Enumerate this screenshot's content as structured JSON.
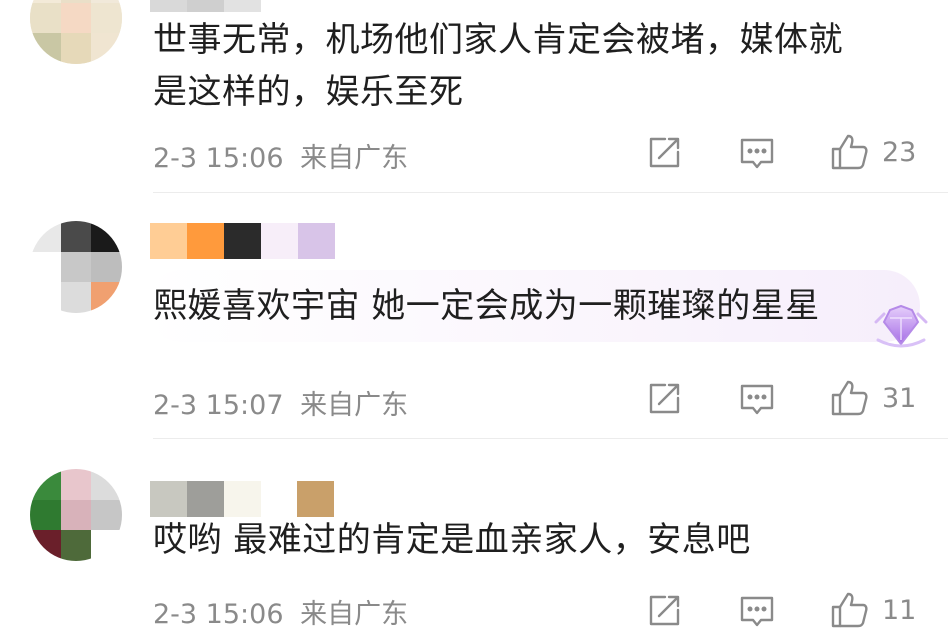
{
  "comments": [
    {
      "text_lines": [
        "世事无常，机场他们家人肯定会被堵，媒体就",
        "是这样的，娱乐至死"
      ],
      "time": "2-3 15:06",
      "location": "来自广东",
      "likes": "23"
    },
    {
      "text_lines": [
        "熙媛喜欢宇宙 她一定会成为一颗璀璨的星星"
      ],
      "time": "2-3 15:07",
      "location": "来自广东",
      "likes": "31",
      "badge_icon": "diamond-badge-icon"
    },
    {
      "text_lines": [
        "哎哟 最难过的肯定是血亲家人，安息吧"
      ],
      "time": "2-3 15:06",
      "location": "来自广东",
      "likes": "11"
    }
  ],
  "icons": {
    "share": "share-icon",
    "reply": "comment-icon",
    "like": "thumbs-up-icon"
  },
  "colors": {
    "meta_gray": "#8a8a8a",
    "badge_purple": "#b07ae8"
  }
}
